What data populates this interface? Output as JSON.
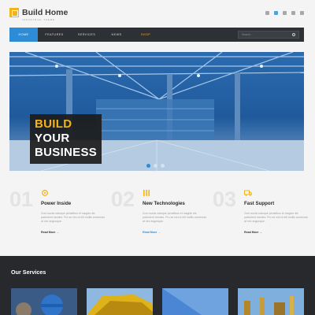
{
  "logo": {
    "title": "Build Home",
    "subtitle": "INDUSTRIAL THEME"
  },
  "social": [
    {
      "name": "facebook-icon",
      "active": false
    },
    {
      "name": "twitter-icon",
      "active": true
    },
    {
      "name": "google-plus-icon",
      "active": false
    },
    {
      "name": "linkedin-icon",
      "active": false
    },
    {
      "name": "skype-icon",
      "active": false
    }
  ],
  "nav": {
    "items": [
      "HOME",
      "FEATURES",
      "SERVICES",
      "NEWS",
      "SHOP"
    ],
    "active": "HOME",
    "search_placeholder": "Search..."
  },
  "hero": {
    "line1": "BUILD",
    "line2": "YOUR",
    "line3": "BUSINESS",
    "slide_count": 3,
    "active_slide": 1
  },
  "features": [
    {
      "num": "01",
      "icon": "gear-icon",
      "title": "Power Inside",
      "text": "Cum sociis natoque penatibus et magnis dis parturient montes. Pro se nisi ut elit mollis commodo at nec augusque.",
      "link": "Read More →"
    },
    {
      "num": "02",
      "icon": "tools-icon",
      "title": "New Technologies",
      "text": "Cum sociis natoque penatibus et magnis dis parturient montes. Pro se nisi ut elit mollis commodo at nec augusque.",
      "link": "Read More →"
    },
    {
      "num": "03",
      "icon": "truck-icon",
      "title": "Fast Support",
      "text": "Cum sociis natoque penatibus et magnis dis parturient montes. Pro se nisi ut elit mollis commodo at nec augusque.",
      "link": "Read More →"
    }
  ],
  "services": {
    "title": "Our Services"
  },
  "colors": {
    "accent": "#2e8cd6",
    "brand": "#f5b31b",
    "dark": "#27292c"
  }
}
